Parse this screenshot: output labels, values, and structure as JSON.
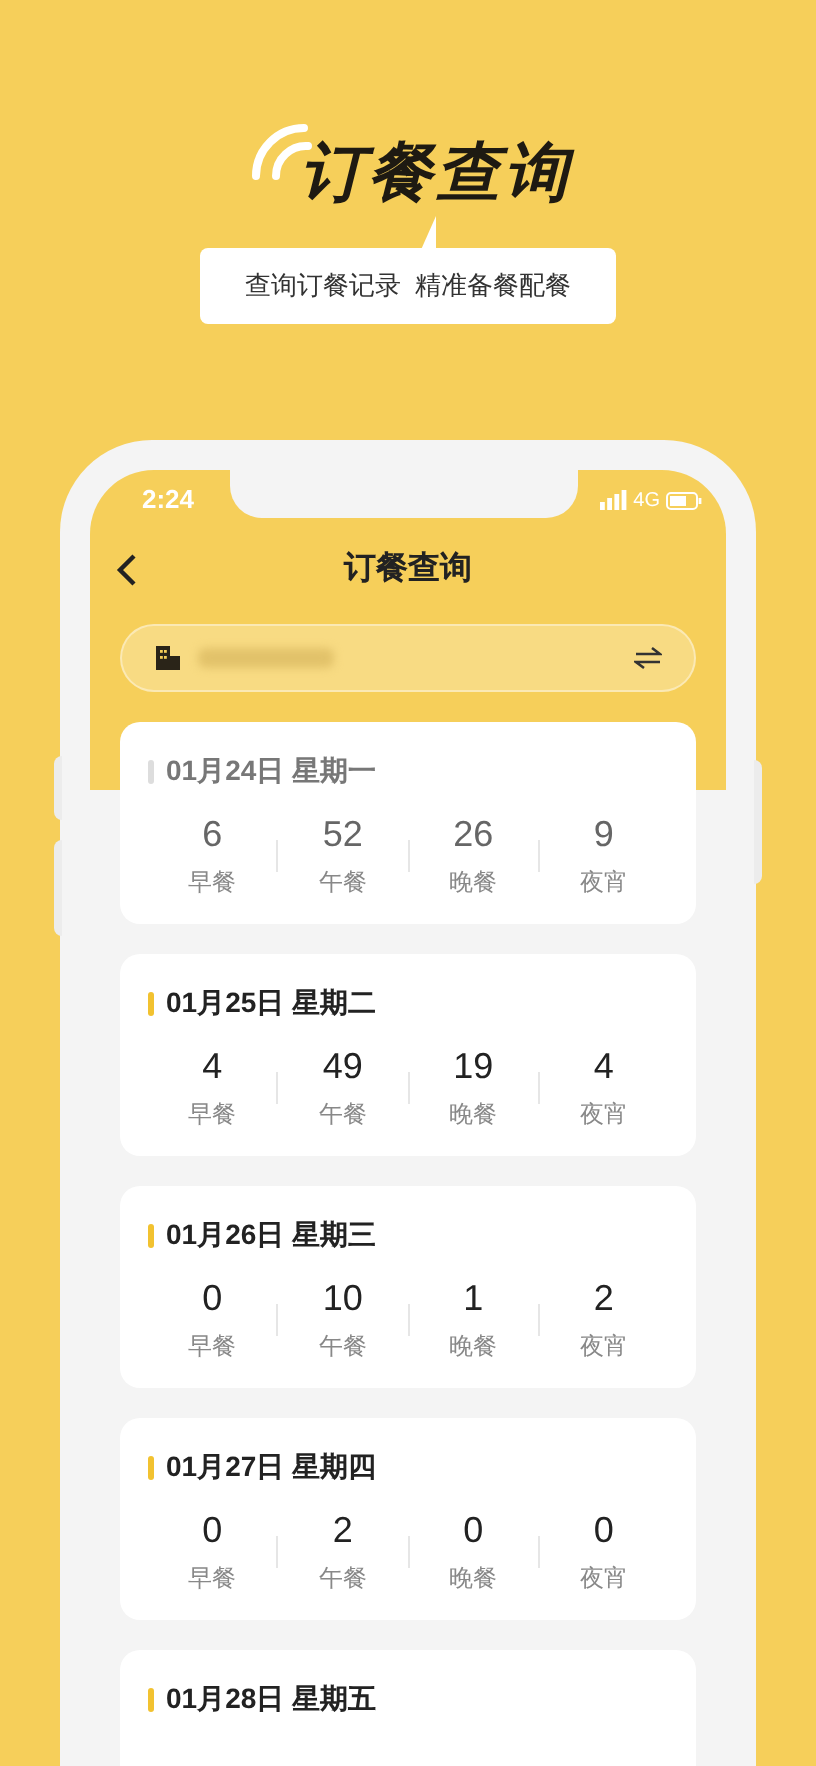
{
  "hero": {
    "title": "订餐查询",
    "subtitle": "查询订餐记录  精准备餐配餐"
  },
  "status_bar": {
    "time": "2:24",
    "network": "4G"
  },
  "nav": {
    "title": "订餐查询"
  },
  "days": [
    {
      "date": "01月24日 星期一",
      "disabled": true,
      "meals": [
        {
          "count": "6",
          "label": "早餐"
        },
        {
          "count": "52",
          "label": "午餐"
        },
        {
          "count": "26",
          "label": "晚餐"
        },
        {
          "count": "9",
          "label": "夜宵"
        }
      ]
    },
    {
      "date": "01月25日 星期二",
      "disabled": false,
      "meals": [
        {
          "count": "4",
          "label": "早餐"
        },
        {
          "count": "49",
          "label": "午餐"
        },
        {
          "count": "19",
          "label": "晚餐"
        },
        {
          "count": "4",
          "label": "夜宵"
        }
      ]
    },
    {
      "date": "01月26日 星期三",
      "disabled": false,
      "meals": [
        {
          "count": "0",
          "label": "早餐"
        },
        {
          "count": "10",
          "label": "午餐"
        },
        {
          "count": "1",
          "label": "晚餐"
        },
        {
          "count": "2",
          "label": "夜宵"
        }
      ]
    },
    {
      "date": "01月27日 星期四",
      "disabled": false,
      "meals": [
        {
          "count": "0",
          "label": "早餐"
        },
        {
          "count": "2",
          "label": "午餐"
        },
        {
          "count": "0",
          "label": "晚餐"
        },
        {
          "count": "0",
          "label": "夜宵"
        }
      ]
    },
    {
      "date": "01月28日 星期五",
      "disabled": false
    }
  ]
}
